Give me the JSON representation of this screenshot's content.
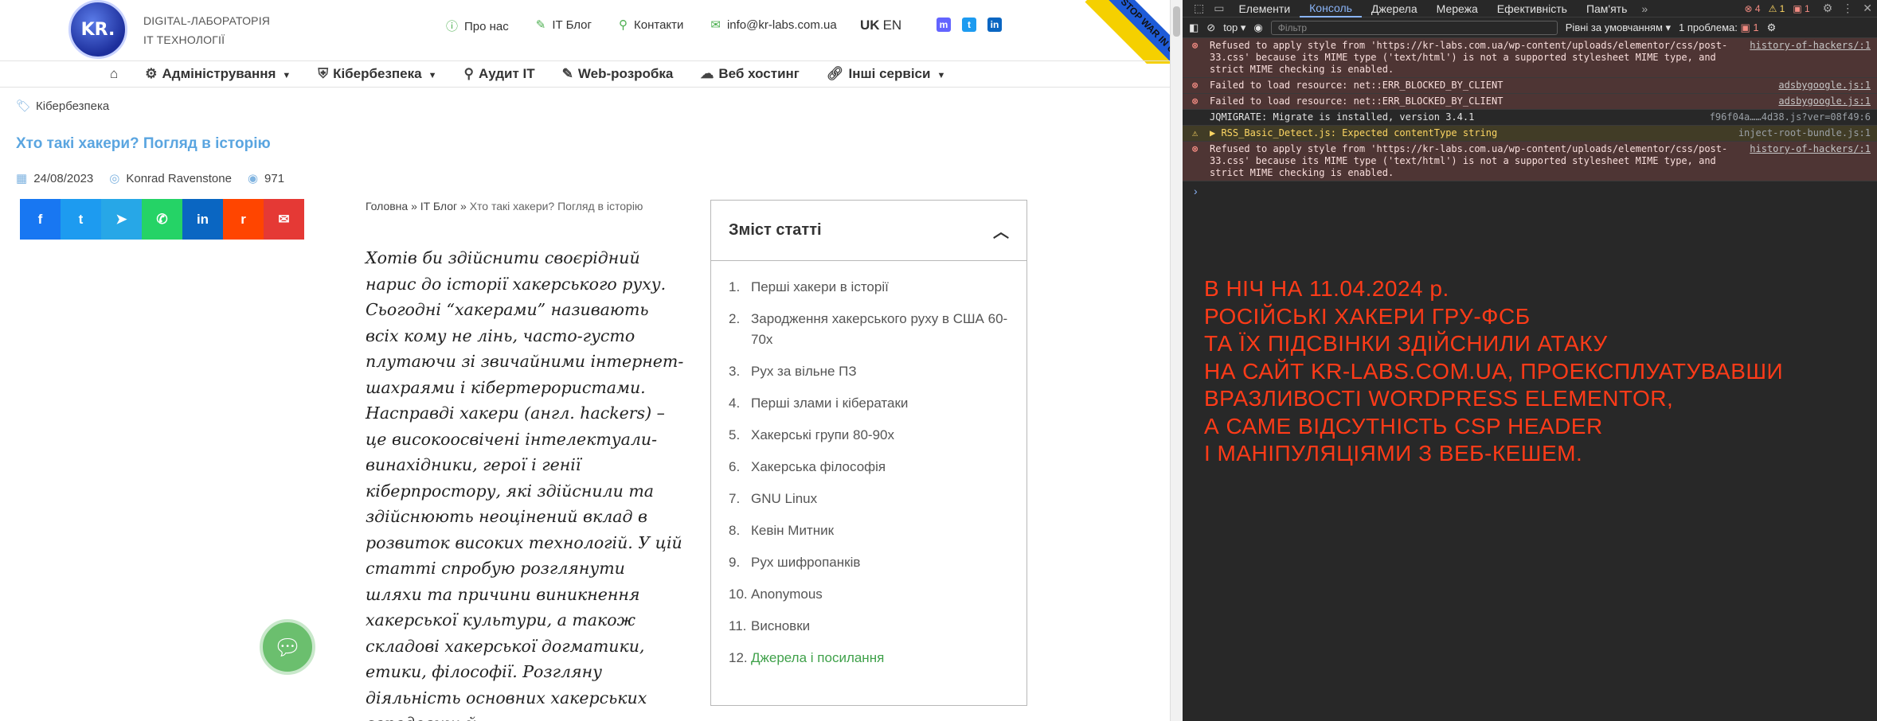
{
  "site": {
    "brand_line1": "DIGITAL-ЛАБОРАТОРІЯ",
    "brand_line2": "IT ТЕХНОЛОГІЇ",
    "logo_text": "KR.",
    "toplinks": [
      "Про нас",
      "IT Блог",
      "Контакти",
      "info@kr-labs.com.ua"
    ],
    "lang_active": "UK",
    "lang_other": "EN",
    "ribbon": "STOP WAR IN UKRAINE",
    "nav": [
      "Адміністрування",
      "Кібербезпека",
      "Аудит IT",
      "Web-розробка",
      "Веб хостинг",
      "Інші сервіси"
    ],
    "category": "Кібербезпека",
    "title": "Хто такі хакери? Погляд в історію",
    "date": "24/08/2023",
    "author": "Konrad Ravenstone",
    "views": "971",
    "breadcrumb": [
      "Головна",
      "IT Блог",
      "Хто такі хакери? Погляд в історію"
    ],
    "article": "Хотів би здійснити своєрідний нарис до історії хакерського руху. Сьогодні “хакерами” називають всіх кому не лінь, часто-густо плутаючи зі звичайними інтернет-шахраями і кібертерористами. Насправді хакери (англ. hackers) – це високоосвічені інтелектуали-винахідники, герої і генії кіберпростору, які здійснили та здійснюють неоцінений вклад в розвиток високих технологій. У цій статті спробую розглянути шляхи та причини виникнення хакерської культури, а також складові хакерської догматики, етики, філософії. Розгляну діяльність основних хакерських середовищ й",
    "toc_title": "Зміст статті",
    "toc": [
      {
        "n": "1.",
        "t": "Перші хакери в історії"
      },
      {
        "n": "2.",
        "t": "Зародження хакерського руху в США 60-70х"
      },
      {
        "n": "3.",
        "t": "Рух за вільне ПЗ"
      },
      {
        "n": "4.",
        "t": "Перші злами і кібератаки"
      },
      {
        "n": "5.",
        "t": "Хакерські групи 80-90х"
      },
      {
        "n": "6.",
        "t": "Хакерська філософія"
      },
      {
        "n": "7.",
        "t": "GNU Linux"
      },
      {
        "n": "8.",
        "t": "Кевін Митник"
      },
      {
        "n": "9.",
        "t": "Рух шифропанків"
      },
      {
        "n": "10.",
        "t": "Anonymous"
      },
      {
        "n": "11.",
        "t": "Висновки"
      },
      {
        "n": "12.",
        "t": "Джерела і посилання"
      }
    ]
  },
  "devtools": {
    "tabs": [
      "Елементи",
      "Консоль",
      "Джерела",
      "Мережа",
      "Ефективність",
      "Пам'ять"
    ],
    "active_tab": "Консоль",
    "counts": {
      "errors": "4",
      "warnings": "1",
      "issues": "1"
    },
    "context": "top",
    "filter_placeholder": "Фільтр",
    "levels": "Рівні за умовчанням",
    "problems": "1 проблема:",
    "problems_count": "1",
    "log": [
      {
        "type": "err",
        "text": "Refused to apply style from 'https://kr-labs.com.ua/wp-content/uploads/elementor/css/post-33.css' because its MIME type ('text/html') is not a supported stylesheet MIME type, and strict MIME checking is enabled.",
        "src": "history-of-hackers/:1"
      },
      {
        "type": "err",
        "text": "Failed to load resource: net::ERR_BLOCKED_BY_CLIENT",
        "src": "adsbygoogle.js:1"
      },
      {
        "type": "err",
        "text": "Failed to load resource: net::ERR_BLOCKED_BY_CLIENT",
        "src": "adsbygoogle.js:1"
      },
      {
        "type": "info",
        "text": "JQMIGRATE: Migrate is installed, version 3.4.1",
        "src": "f96f04a……4d38.js?ver=08f49:6"
      },
      {
        "type": "warn",
        "text": "▶ RSS_Basic_Detect.js: Expected contentType string",
        "src": "inject-root-bundle.js:1"
      },
      {
        "type": "err",
        "text": "Refused to apply style from 'https://kr-labs.com.ua/wp-content/uploads/elementor/css/post-33.css' because its MIME type ('text/html') is not a supported stylesheet MIME type, and strict MIME checking is enabled.",
        "src": "history-of-hackers/:1"
      }
    ],
    "notice": "В НІЧ НА 11.04.2024 р.\nРОСІЙСЬКІ ХАКЕРИ ГРУ-ФСБ\nТА ЇХ ПІДСВІНКИ ЗДІЙСНИЛИ АТАКУ\nНА САЙТ KR-LABS.COM.UA, ПРОЕКСПЛУАТУВАВШИ\nВРАЗЛИВОСТІ WORDPRESS ELEMENTOR,\nА САМЕ ВІДСУТНІСТЬ CSP HEADER\nІ МАНІПУЛЯЦІЯМИ З ВЕБ-КЕШЕМ."
  }
}
